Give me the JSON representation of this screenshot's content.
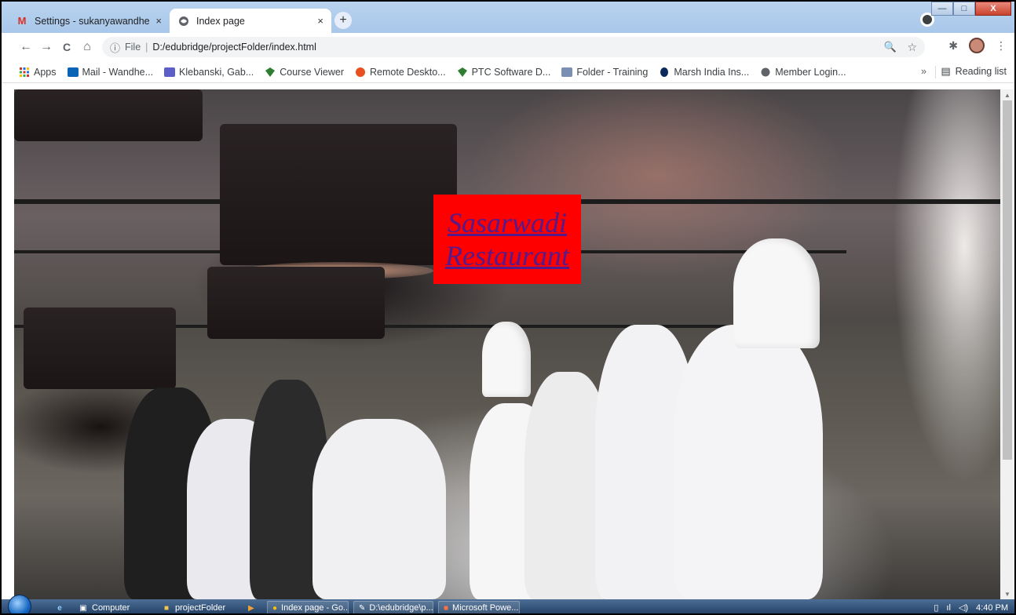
{
  "browser": {
    "tabs": [
      {
        "title": "Settings - sukanyawandhe",
        "icon": "gmail-icon",
        "close": "×"
      },
      {
        "title": "Index page",
        "icon": "globe-icon",
        "close": "×"
      }
    ],
    "new_tab": "+",
    "window_buttons": {
      "minimize": "—",
      "maximize": "□",
      "close": "X"
    },
    "nav": {
      "back": "←",
      "forward": "→",
      "reload": "C",
      "home": "⌂"
    },
    "address": {
      "info_icon": "ⓘ",
      "scheme": "File",
      "separator": "|",
      "url": "D:/edubridge/projectFolder/index.html",
      "zoom": "🔍",
      "star": "☆"
    },
    "extensions_icon": "✱",
    "menu": "⋮",
    "bookmarks": [
      {
        "label": "Apps",
        "icon": "apps-grid-icon"
      },
      {
        "label": "Mail - Wandhe...",
        "icon": "outlook-icon"
      },
      {
        "label": "Klebanski, Gab...",
        "icon": "teams-icon"
      },
      {
        "label": "Course Viewer",
        "icon": "course-icon"
      },
      {
        "label": "Remote Deskto...",
        "icon": "remote-desktop-icon"
      },
      {
        "label": "PTC Software D...",
        "icon": "ptc-icon"
      },
      {
        "label": "Folder - Training",
        "icon": "folder-icon"
      },
      {
        "label": "Marsh India Ins...",
        "icon": "marsh-icon"
      },
      {
        "label": "Member Login...",
        "icon": "globe-icon"
      }
    ],
    "bookmarks_more": "»",
    "reading_list": "Reading list"
  },
  "page": {
    "heading_line1": "Sasarwadi",
    "heading_line2": "Restaurant",
    "background_image": "restaurant staff and chefs under hanging lamps"
  },
  "taskbar": {
    "items": [
      {
        "label": "Computer",
        "icon": "computer-icon"
      },
      {
        "label": "projectFolder",
        "icon": "folder-icon"
      },
      {
        "label": "Index page - Go...",
        "icon": "chrome-icon"
      },
      {
        "label": "D:\\edubridge\\p...",
        "icon": "notepad-icon"
      },
      {
        "label": "Microsoft Powe...",
        "icon": "powerpoint-icon"
      }
    ],
    "clock": "4:40 PM"
  },
  "colors": {
    "sign_bg": "#ff0000",
    "heading_link": "#551a8b",
    "tabstrip": "#b9d3ef"
  }
}
